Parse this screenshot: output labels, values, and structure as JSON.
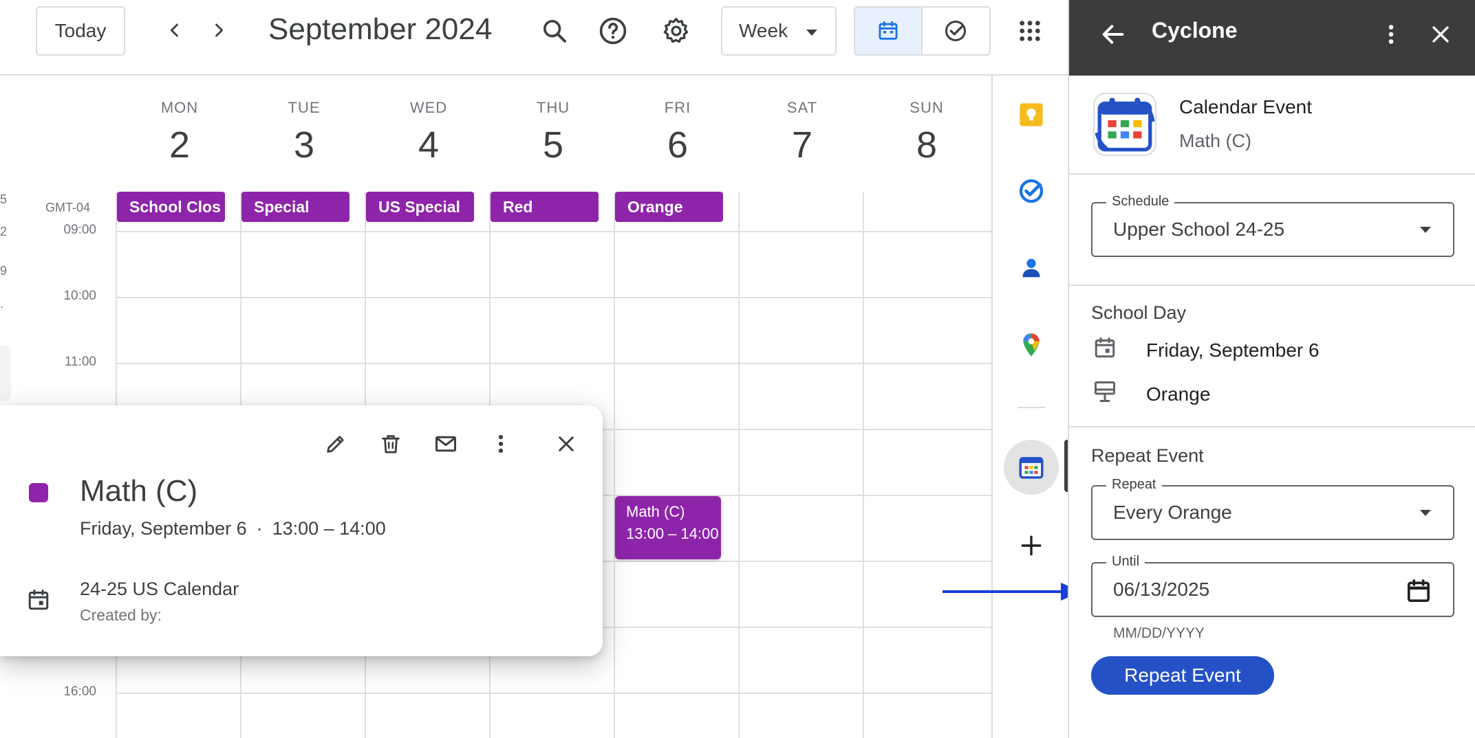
{
  "topbar": {
    "today_label": "Today",
    "title": "September 2024",
    "view_label": "Week"
  },
  "week": {
    "days": [
      {
        "dow": "MON",
        "num": "2"
      },
      {
        "dow": "TUE",
        "num": "3"
      },
      {
        "dow": "WED",
        "num": "4"
      },
      {
        "dow": "THU",
        "num": "5"
      },
      {
        "dow": "FRI",
        "num": "6"
      },
      {
        "dow": "SAT",
        "num": "7"
      },
      {
        "dow": "SUN",
        "num": "8"
      }
    ],
    "timezone": "GMT-04",
    "all_day_events": [
      "School Clos",
      "Special",
      "US Special",
      "Red",
      "Orange"
    ],
    "hours": [
      "09:00",
      "10:00",
      "11:00",
      "16:00"
    ],
    "edge_fragments": [
      "5",
      "2",
      "9",
      "."
    ]
  },
  "event_block": {
    "title": "Math (C)",
    "time": "13:00 – 14:00"
  },
  "popup": {
    "title": "Math (C)",
    "date": "Friday, September 6",
    "dot": "·",
    "time": "13:00 – 14:00",
    "calendar_name": "24-25 US Calendar",
    "created_by": "Created by:"
  },
  "panel": {
    "header_title": "Cyclone",
    "event_type": "Calendar Event",
    "event_name": "Math (C)",
    "schedule_label": "Schedule",
    "schedule_value": "Upper School 24-25",
    "school_day_heading": "School Day",
    "school_day_date": "Friday, September 6",
    "school_day_rotation": "Orange",
    "repeat_heading": "Repeat Event",
    "repeat_label": "Repeat",
    "repeat_value": "Every Orange",
    "until_label": "Until",
    "until_value": "06/13/2025",
    "until_helper": "MM/DD/YYYY",
    "repeat_button": "Repeat Event"
  },
  "colors": {
    "event_purple": "#8e24aa",
    "primary_blue": "#2451c6",
    "panel_header": "#3c3c3c",
    "arrow_blue": "#1a3fd8"
  },
  "icons": [
    "back-arrow-icon",
    "search-icon",
    "help-icon",
    "gear-icon",
    "apps-grid-icon",
    "calendar-icon",
    "tasks-check-icon",
    "keep-icon",
    "contacts-icon",
    "maps-icon",
    "add-icon",
    "edit-icon",
    "delete-icon",
    "email-icon",
    "more-vert-icon",
    "close-icon"
  ]
}
